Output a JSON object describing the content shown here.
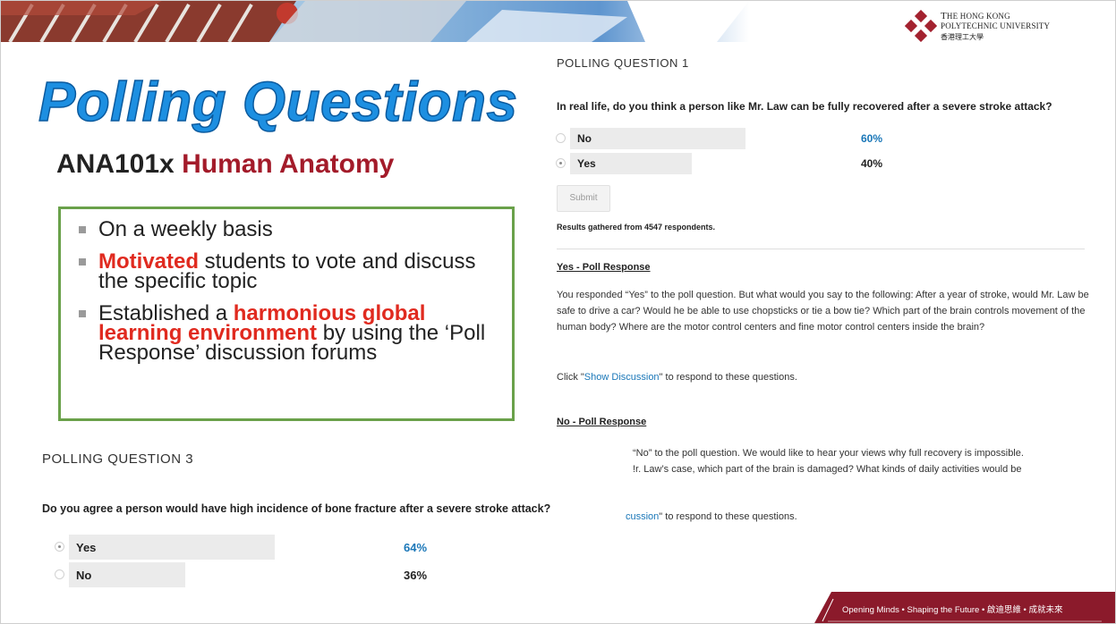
{
  "slide": {
    "title": "Polling Questions",
    "course_code": "ANA101x",
    "course_name": "Human Anatomy",
    "bullets": [
      {
        "prefix": "",
        "highlight": "",
        "text": "On a weekly basis"
      },
      {
        "prefix": "",
        "highlight": "Motivated",
        "text": " students to vote and discuss the specific topic"
      },
      {
        "prefix": "Established a ",
        "highlight": "harmonious global learning environment",
        "text": " by using the ‘Poll Response’ discussion forums"
      }
    ]
  },
  "logo": {
    "name_line1_cap": "T",
    "name_line1_rest": "HE HONG KONG",
    "name_line2": "POLYTECHNIC UNIVERSITY",
    "name_zh": "香港理工大學"
  },
  "poll1": {
    "heading": "POLLING QUESTION 1",
    "question": "In real life, do you think a person like Mr. Law can be fully recovered after a severe stroke attack?",
    "options": [
      {
        "label": "No",
        "percent": "60%",
        "value": 60,
        "selected": false,
        "highlight": true
      },
      {
        "label": "Yes",
        "percent": "40%",
        "value": 40,
        "selected": true,
        "highlight": false
      }
    ],
    "submit_label": "Submit",
    "results": "Results gathered from 4547 respondents."
  },
  "yes_response": {
    "title": "Yes - Poll Response",
    "text": "You responded “Yes” to the poll question. But what would you say to the following: After a year of stroke, would Mr. Law be safe to drive a car? Would he be able to use chopsticks or tie a bow tie? Which part of the brain controls movement of the human body? Where are the motor control centers and fine motor control centers inside the brain?",
    "click_prefix": "Click \"",
    "click_link": "Show Discussion",
    "click_suffix": "\" to respond to these questions."
  },
  "no_response": {
    "title": "No - Poll Response",
    "line1": "“No” to the poll question. We would like to hear your views why full recovery is impossible.",
    "line2": "!r. Law’s case, which part of the brain is damaged? What kinds of daily activities would be",
    "click_link": "cussion",
    "click_suffix": "\" to respond to these questions."
  },
  "poll3": {
    "heading": "POLLING QUESTION 3",
    "question": "Do you agree a person would have high incidence of bone fracture after a severe stroke attack?",
    "options": [
      {
        "label": "Yes",
        "percent": "64%",
        "value": 64,
        "selected": true,
        "highlight": true
      },
      {
        "label": "No",
        "percent": "36%",
        "value": 36,
        "selected": false,
        "highlight": false
      }
    ]
  },
  "footer": {
    "text": "Opening Minds • Shaping the Future • 啟迪思維 • 成就未來"
  },
  "colors": {
    "title_blue": "#1d8fe1",
    "course_red": "#a31b2a",
    "highlight_red": "#e02a1f",
    "box_green": "#6aa14a",
    "link_blue": "#1a77b8",
    "footer_maroon": "#8b1a2b"
  }
}
